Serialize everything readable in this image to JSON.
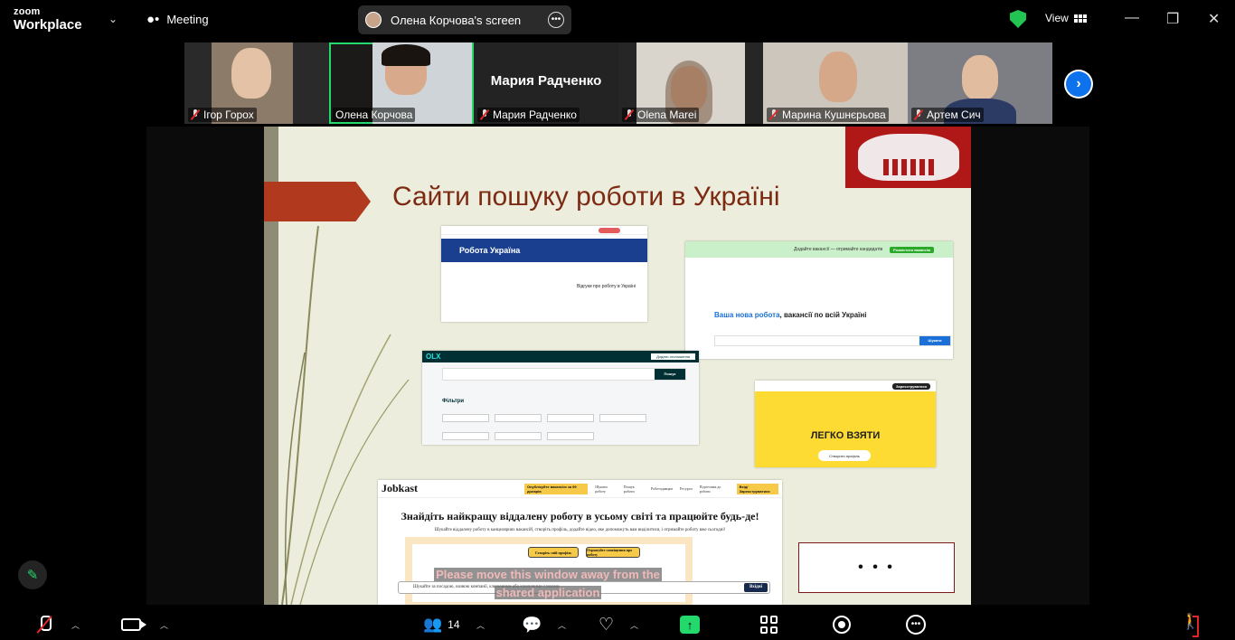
{
  "app": {
    "logo_line1": "zoom",
    "logo_line2": "Workplace",
    "meeting_label": "Meeting",
    "screen_pill_label": "Олена Корчова's screen",
    "view_label": "View",
    "window_controls": {
      "minimize": "—",
      "restore": "❐",
      "close": "✕"
    }
  },
  "participants": [
    {
      "name": "Ігор Горох",
      "muted": true,
      "video": true
    },
    {
      "name": "Олена Корчова",
      "muted": false,
      "video": true,
      "active_speaker": true
    },
    {
      "name": "Мария Радченко",
      "muted": true,
      "video": false,
      "display_name": "Мария Радченко"
    },
    {
      "name": "Olena Marei",
      "muted": true,
      "video": true
    },
    {
      "name": "Марина Кушнєрьова",
      "muted": true,
      "video": true
    },
    {
      "name": "Артем Сич",
      "muted": true,
      "video": true
    }
  ],
  "slide": {
    "title": "Сайти пошуку роботи в Україні",
    "site1": {
      "banner": "Робота Україна",
      "text": "Відгуки про роботу в Україні"
    },
    "site2": {
      "top_banner": "Додайте вакансії — отримайте кандидатів",
      "top_button": "Розмістити вакансію",
      "headline_accent": "Ваша нова робота",
      "headline_rest": ", вакансії по всій Україні",
      "search_button": "Шукати"
    },
    "site3": {
      "brand": "OLX",
      "post_button": "Додати оголошення",
      "search_button": "Пошук",
      "filters_label": "Фільтри"
    },
    "site4": {
      "headline": "ЛЕГКО ВЗЯТИ",
      "button": "Створити профіль",
      "top_button": "Зареєструватися"
    },
    "site5": {
      "brand": "Jobkast",
      "badge": "Опублікуйте вакансію за 99 доларів",
      "nav1": "Шукати роботу",
      "nav2": "Пошук роботи",
      "nav3": "Роботодавцям",
      "nav4": "Ресурси",
      "nav5": "Підготовка до роботи",
      "login": "Вхід/ Зареєструватися",
      "headline": "Знайдіть найкращу віддалену роботу в усьому світі та працюйте будь-де!",
      "subtext": "Шукайте віддалену роботу в канцеляриях вакансій, створіть профіль, додайте відео, яке допоможуть вам виділитися, і отримайте роботу вже сьогодні!",
      "button1": "Створіть свій профіль",
      "button2": "Отримуйте сповіщення про роботу",
      "search_placeholder": "Шукайте за посадою, назвою компанії, ключовими або ключовими словами",
      "search_button": "Вхідні"
    },
    "warning_line1": "Please move this window away from the",
    "warning_line2": "shared application",
    "dots": "• • •"
  },
  "toolbar": {
    "participants_count": "14"
  }
}
